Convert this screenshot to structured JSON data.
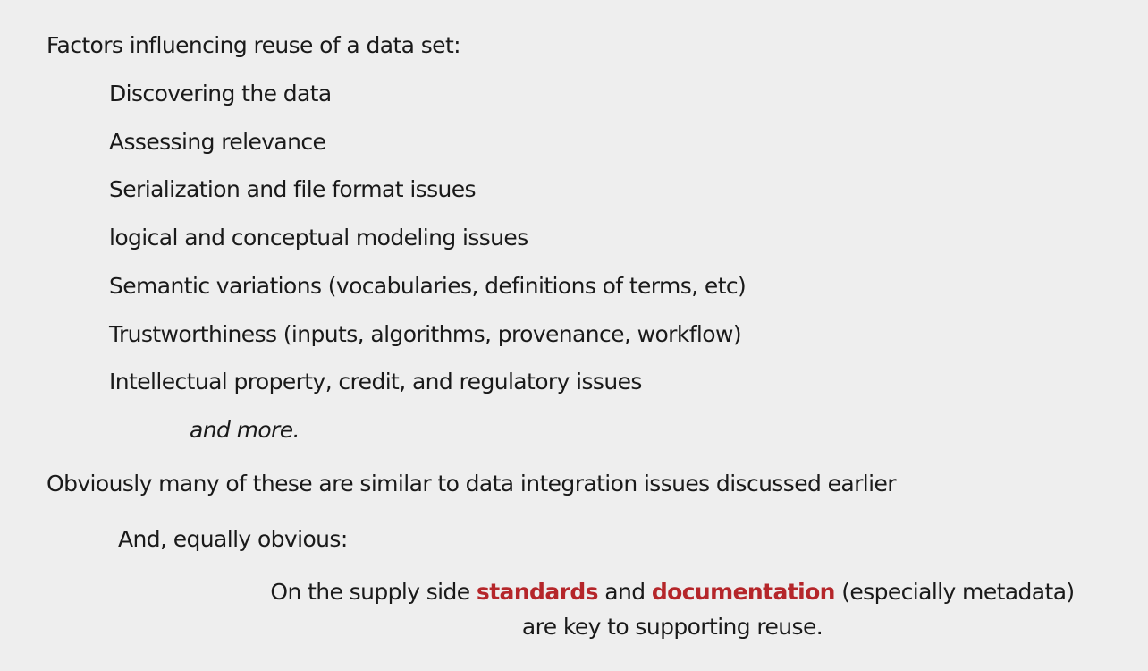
{
  "slide": {
    "heading": "Factors influencing reuse of a data set:",
    "factors": [
      "Discovering the data",
      "Assessing relevance",
      "Serialization and file format issues",
      "logical and conceptual modeling issues",
      "Semantic variations (vocabularies, definitions of terms, etc)",
      "Trustworthiness (inputs, algorithms, provenance, workflow)",
      "Intellectual property, credit, and regulatory issues"
    ],
    "and_more": "and more.",
    "observation": "Obviously many of these are similar to data integration issues discussed earlier",
    "equally_obvious": "And, equally obvious:",
    "conclusion": {
      "prefix": "On the supply side ",
      "term1": "standards",
      "middle": " and ",
      "term2": "documentation",
      "suffix": " (especially metadata)",
      "line2": "are key to supporting reuse."
    },
    "accent_color": "#b5262a"
  }
}
